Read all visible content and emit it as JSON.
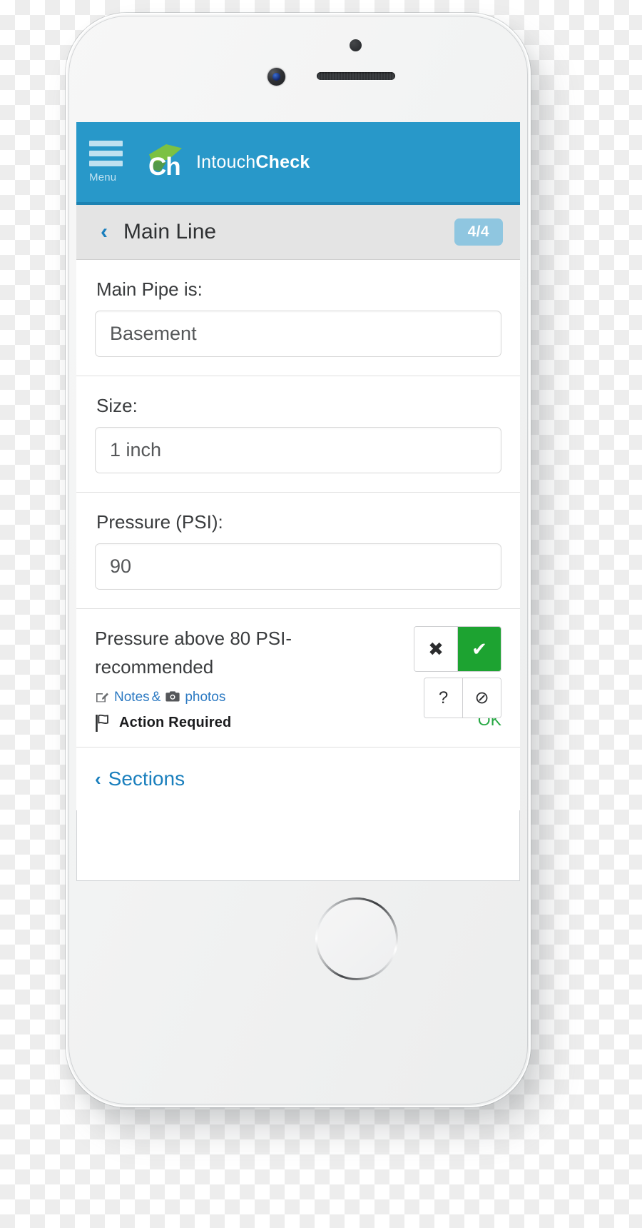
{
  "app": {
    "menu_label": "Menu",
    "brand_mark_text": "Ch",
    "brand_name_light": "Intouch",
    "brand_name_bold": "Check",
    "accent_blue": "#2898c9",
    "accent_green": "#7cc143",
    "link_blue": "#1a7fbd",
    "success_green": "#1da331"
  },
  "subheader": {
    "back_icon": "‹",
    "title": "Main Line",
    "progress_badge": "4/4"
  },
  "form": {
    "fields": [
      {
        "label": "Main Pipe is:",
        "value": "Basement"
      },
      {
        "label": "Size:",
        "value": "1 inch"
      },
      {
        "label": "Pressure (PSI):",
        "value": "90"
      }
    ]
  },
  "question": {
    "text": "Pressure above 80 PSI-recommended",
    "notes_label": "Notes",
    "notes_amp": "&",
    "photos_label": "photos",
    "action_label": "Action Required",
    "status_text": "OK",
    "answers": [
      {
        "name": "fail",
        "glyph": "✖",
        "selected": false
      },
      {
        "name": "pass",
        "glyph": "✔",
        "selected": true
      }
    ],
    "secondary": [
      {
        "name": "unknown",
        "glyph": "?"
      },
      {
        "name": "not-applicable",
        "glyph": "⊘"
      }
    ]
  },
  "footer": {
    "sections_chevron": "‹",
    "sections_label": "Sections"
  }
}
